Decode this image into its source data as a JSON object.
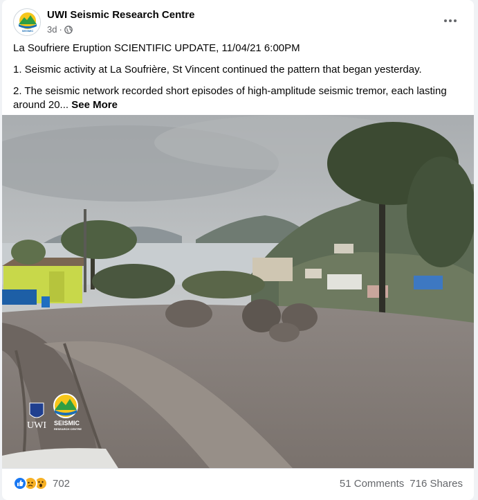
{
  "post": {
    "page_name": "UWI Seismic Research Centre",
    "time": "3d",
    "separator": "·",
    "line1": "La Soufriere Eruption SCIENTIFIC UPDATE, 11/04/21 6:00PM",
    "line2": "1. Seismic activity at La Soufrière, St Vincent continued the pattern that began yesterday.",
    "line3": "2. The seismic network recorded short episodes of high-amplitude seismic tremor, each lasting around 20...",
    "see_more": "See More"
  },
  "photo": {
    "watermark_uwi": "UWI",
    "watermark_seismic": "SEISMIC",
    "watermark_centre": "RESEARCH CENTRE"
  },
  "footer": {
    "reaction_count": "702",
    "comments": "51 Comments",
    "shares": "716 Shares"
  },
  "icons": {
    "avatar": "seismic-logo-icon",
    "privacy": "globe-icon",
    "menu": "more-options-icon",
    "reactions": [
      "like-icon",
      "sad-icon",
      "wow-icon"
    ]
  },
  "colors": {
    "link_blue": "#1877f2",
    "muted": "#65676b"
  }
}
